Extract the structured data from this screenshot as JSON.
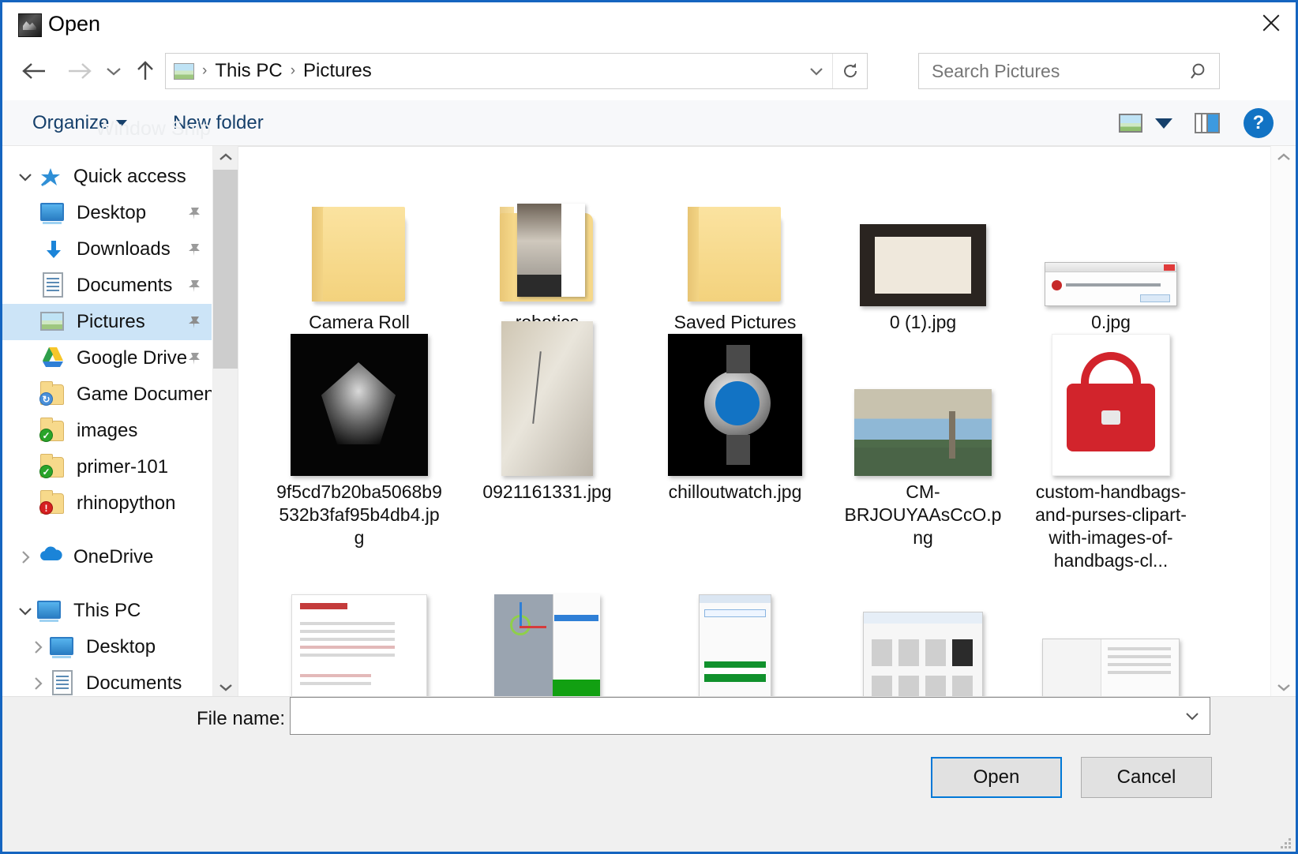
{
  "window": {
    "title": "Open",
    "title_icon": "rhino-app-icon",
    "close_label": "✕"
  },
  "nav": {
    "back_icon": "back-arrow-icon",
    "forward_icon": "forward-arrow-icon",
    "recent_icon": "recent-locations-chevron-icon",
    "up_icon": "up-arrow-icon",
    "address_icon": "pictures-folder-icon",
    "breadcrumbs": [
      "This PC",
      "Pictures"
    ],
    "separator": "›",
    "dropdown_icon": "chevron-down-icon",
    "refresh_icon": "refresh-icon"
  },
  "search": {
    "placeholder": "Search Pictures",
    "value": "",
    "icon": "search-icon"
  },
  "toolbar": {
    "organize_label": "Organize",
    "new_folder_label": "New folder",
    "watermark": "Window Ship",
    "view_icon": "view-options-icon",
    "view_caret_icon": "chevron-down-icon",
    "preview_pane_icon": "preview-pane-toggle-icon",
    "help_label": "?",
    "help_icon": "help-icon"
  },
  "sidebar": {
    "scroll_up_icon": "scroll-up-arrow-icon",
    "scroll_down_icon": "scroll-down-arrow-icon",
    "groups": [
      {
        "label": "Quick access",
        "icon": "quick-access-star-icon",
        "expanded": true,
        "twisty": "chevron-down-icon",
        "items": [
          {
            "label": "Desktop",
            "icon": "desktop-monitor-icon",
            "pinned": true
          },
          {
            "label": "Downloads",
            "icon": "downloads-arrow-icon",
            "pinned": true
          },
          {
            "label": "Documents",
            "icon": "documents-file-icon",
            "pinned": true
          },
          {
            "label": "Pictures",
            "icon": "pictures-image-icon",
            "pinned": true,
            "selected": true
          },
          {
            "label": "Google Drive",
            "icon": "google-drive-icon",
            "pinned": true
          },
          {
            "label": "Game Documen",
            "icon": "folder-sync-icon",
            "pinned": false
          },
          {
            "label": "images",
            "icon": "folder-check-icon",
            "pinned": false
          },
          {
            "label": "primer-101",
            "icon": "folder-check-icon",
            "pinned": false
          },
          {
            "label": "rhinopython",
            "icon": "folder-alert-icon",
            "pinned": false
          }
        ]
      },
      {
        "label": "OneDrive",
        "icon": "onedrive-cloud-icon",
        "expanded": false,
        "twisty": "chevron-right-icon",
        "items": []
      },
      {
        "label": "This PC",
        "icon": "this-pc-monitor-icon",
        "expanded": true,
        "twisty": "chevron-down-icon",
        "items": [
          {
            "label": "Desktop",
            "icon": "desktop-monitor-icon",
            "twisty": "chevron-right-icon"
          },
          {
            "label": "Documents",
            "icon": "documents-file-icon",
            "twisty": "chevron-right-icon"
          }
        ]
      }
    ]
  },
  "files": {
    "items": [
      {
        "name": "Camera Roll",
        "kind": "folder"
      },
      {
        "name": "robotics",
        "kind": "folder-preview"
      },
      {
        "name": "Saved Pictures",
        "kind": "folder"
      },
      {
        "name": "0 (1).jpg",
        "kind": "image-framed-card"
      },
      {
        "name": "0.jpg",
        "kind": "image-error-dialog"
      },
      {
        "name": "9f5cd7b20ba5068b9532b3faf95b4db4.jpg",
        "kind": "image-dark-web"
      },
      {
        "name": "0921161331.jpg",
        "kind": "image-note-paper"
      },
      {
        "name": "chilloutwatch.jpg",
        "kind": "image-watch"
      },
      {
        "name": "CM-BRJOUYAAsCcO.png",
        "kind": "image-cityscape"
      },
      {
        "name": "custom-handbags-and-purses-clipart-with-images-of-handbags-cl...",
        "kind": "image-red-handbag"
      },
      {
        "name": "",
        "kind": "screenshot-webpage"
      },
      {
        "name": "",
        "kind": "screenshot-rhino"
      },
      {
        "name": "",
        "kind": "screenshot-dialog"
      },
      {
        "name": "",
        "kind": "screenshot-grid"
      },
      {
        "name": "",
        "kind": "screenshot-wide"
      }
    ]
  },
  "footer": {
    "file_name_label": "File name:",
    "file_name_value": "",
    "file_name_dropdown_icon": "chevron-down-icon",
    "open_label": "Open",
    "cancel_label": "Cancel",
    "resize_grip_icon": "resize-grip-icon"
  },
  "colors": {
    "window_border": "#1565c0",
    "selection": "#cce4f7",
    "accent": "#0078d7",
    "link_text": "#16406b",
    "help_blue": "#1273c4"
  }
}
